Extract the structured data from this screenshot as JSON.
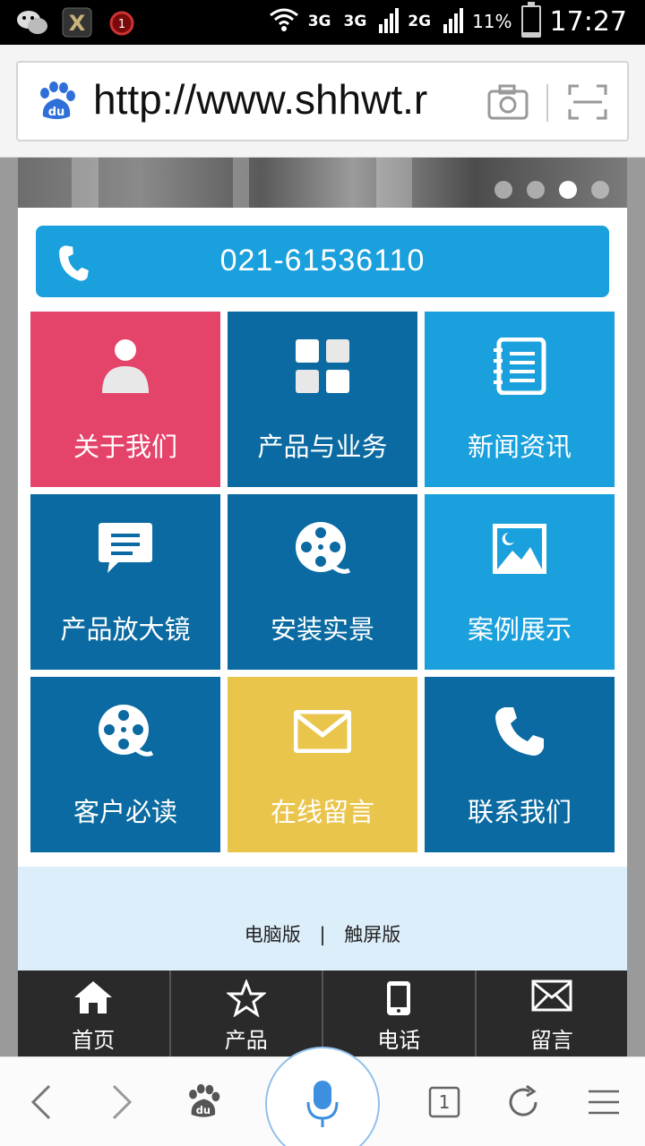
{
  "status_bar": {
    "left_icons": [
      "wechat-icon",
      "app-x-icon",
      "alarm-icon"
    ],
    "alarm_count": "1",
    "network_labels": [
      "3G",
      "3G",
      "2G"
    ],
    "battery_percent": "11%",
    "time": "17:27"
  },
  "browser": {
    "url": "http://www.shhwt.r"
  },
  "banner": {
    "slide_count": 4,
    "active_slide": 3
  },
  "phone_bar": {
    "number": "021-61536110"
  },
  "tiles": [
    {
      "label": "关于我们",
      "icon": "user-icon",
      "color": "#e5446a"
    },
    {
      "label": "产品与业务",
      "icon": "grid-icon",
      "color": "#0a6aa1"
    },
    {
      "label": "新闻资讯",
      "icon": "notebook-icon",
      "color": "#1aa0dc"
    },
    {
      "label": "产品放大镜",
      "icon": "chat-bubble-icon",
      "color": "#0a6aa1"
    },
    {
      "label": "安装实景",
      "icon": "film-reel-icon",
      "color": "#0a6aa1"
    },
    {
      "label": "案例展示",
      "icon": "picture-icon",
      "color": "#1aa0dc"
    },
    {
      "label": "客户必读",
      "icon": "film-reel-icon",
      "color": "#0a6aa1"
    },
    {
      "label": "在线留言",
      "icon": "envelope-icon",
      "color": "#eac54c"
    },
    {
      "label": "联系我们",
      "icon": "phone-icon",
      "color": "#0a6aa1"
    }
  ],
  "footer": {
    "pc_version": "电脑版",
    "separator": "|",
    "touch_version": "触屏版"
  },
  "bottom_nav": [
    {
      "label": "首页",
      "icon": "home-icon"
    },
    {
      "label": "产品",
      "icon": "star-icon"
    },
    {
      "label": "电话",
      "icon": "mobile-phone-icon"
    },
    {
      "label": "留言",
      "icon": "envelope-icon"
    }
  ],
  "browser_toolbar": {
    "tab_count": "1",
    "icons": [
      "back-icon",
      "forward-icon",
      "baidu-paw-icon",
      "microphone-icon",
      "tabs-icon",
      "refresh-icon",
      "menu-icon"
    ]
  }
}
